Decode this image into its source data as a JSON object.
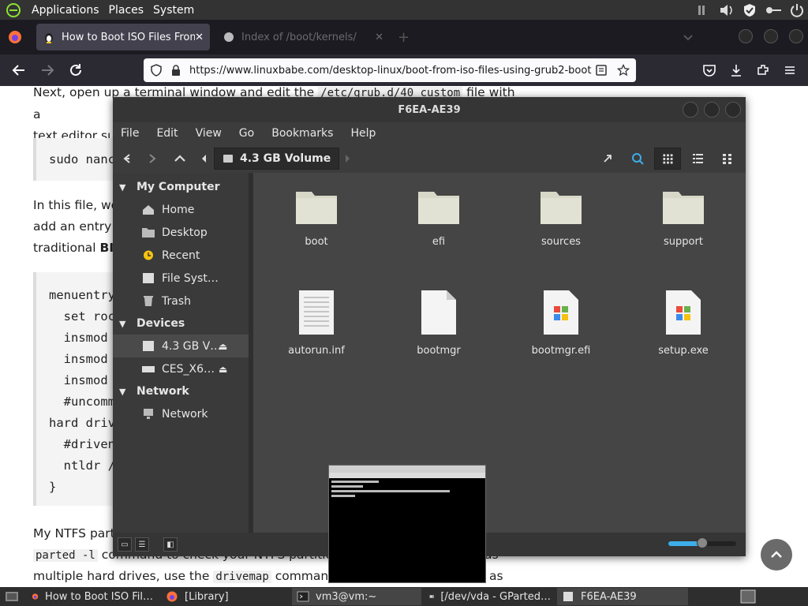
{
  "panel": {
    "menus": [
      "Applications",
      "Places",
      "System"
    ]
  },
  "browser": {
    "tabs": [
      {
        "title": "How to Boot ISO Files From",
        "close": "✕"
      },
      {
        "title": "Index of /boot/kernels/",
        "close": "✕"
      }
    ],
    "new_tab": "+",
    "url": "https://www.linuxbabe.com/desktop-linux/boot-from-iso-files-using-grub2-boot"
  },
  "article": {
    "p1a": "Next, open up a terminal window and edit the",
    "p1code": "/etc/grub.d/40_custom",
    "p1b": "file with a",
    "p1c": "text editor suc",
    "cmd": "sudo nanc",
    "p2a": "In this file, we",
    "p2b": "add an entry t",
    "p2c": "traditional",
    "p2c_bold": "BIC",
    "code_lines": [
      "menuentry",
      "  set roc",
      "  insmod",
      "  insmod",
      "  insmod",
      "  #uncomm",
      "hard driv",
      "  #driven",
      "  ntldr /",
      "}"
    ],
    "p3a": "My NTFS parti",
    "p4code": "parted -l",
    "p4a": "command to check your NTFS partition",
    "p4b": "as",
    "p5a": "multiple hard drives, use the",
    "p5code": "drivemap",
    "p5b": "command t",
    "p5c": "as the"
  },
  "filemanager": {
    "title": "F6EA-AE39",
    "menu": [
      "File",
      "Edit",
      "View",
      "Go",
      "Bookmarks",
      "Help"
    ],
    "location": "4.3 GB Volume",
    "sidebar": {
      "sections": [
        {
          "title": "My Computer",
          "items": [
            "Home",
            "Desktop",
            "Recent",
            "File Syst…",
            "Trash"
          ]
        },
        {
          "title": "Devices",
          "items": [
            "4.3 GB V…",
            "CES_X6…"
          ]
        },
        {
          "title": "Network",
          "items": [
            "Network"
          ]
        }
      ]
    },
    "files": [
      {
        "name": "boot",
        "kind": "folder"
      },
      {
        "name": "efi",
        "kind": "folder"
      },
      {
        "name": "sources",
        "kind": "folder"
      },
      {
        "name": "support",
        "kind": "folder"
      },
      {
        "name": "autorun.inf",
        "kind": "text"
      },
      {
        "name": "bootmgr",
        "kind": "blank"
      },
      {
        "name": "bootmgr.efi",
        "kind": "windows"
      },
      {
        "name": "setup.exe",
        "kind": "windows"
      }
    ],
    "zoom_level": 0.5
  },
  "taskbar": {
    "items": [
      "How to Boot ISO Fil…",
      "[Library]",
      "vm3@vm:~",
      "[/dev/vda - GParted…",
      "F6EA-AE39"
    ]
  },
  "colors": {
    "accent": "#3daee9",
    "fm_bg": "#454545",
    "folder": "#d8d8c8"
  }
}
